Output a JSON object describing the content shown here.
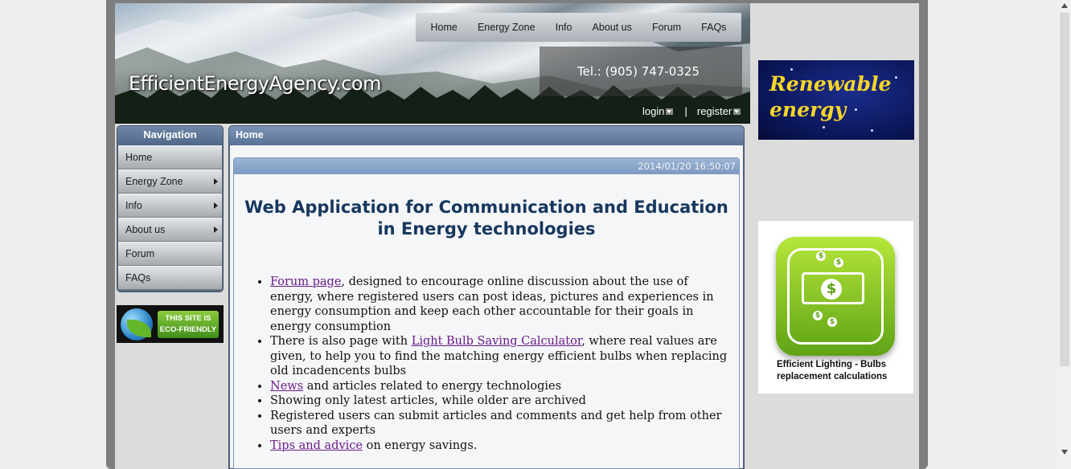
{
  "header": {
    "logo_text": "EfficientEnergyAgency.com",
    "phone": "Tel.: (905) 747-0325",
    "top_nav": [
      "Home",
      "Energy Zone",
      "Info",
      "About us",
      "Forum",
      "FAQs"
    ],
    "login_label": "login",
    "register_label": "register",
    "separator": "|"
  },
  "sidebar": {
    "title": "Navigation",
    "items": [
      {
        "label": "Home",
        "has_submenu": false
      },
      {
        "label": "Energy Zone",
        "has_submenu": true
      },
      {
        "label": "Info",
        "has_submenu": true
      },
      {
        "label": "About us",
        "has_submenu": true
      },
      {
        "label": "Forum",
        "has_submenu": false
      },
      {
        "label": "FAQs",
        "has_submenu": false
      }
    ],
    "eco_badge": "THIS SITE IS ECO-FRIENDLY"
  },
  "main": {
    "breadcrumb": "Home",
    "article": {
      "timestamp": "2014/01/20 16:50:07",
      "title": "Web Application for Communication and Education in Energy technologies",
      "bullets": [
        {
          "link": "Forum page",
          "text": ", designed to encourage online discussion about the use of energy, where registered users can post ideas, pictures and experiences in energy consumption and keep each other accountable for their goals in energy consumption"
        },
        {
          "prefix": "There is also page with ",
          "link": "Light Bulb Saving Calculator",
          "text": ", where real values are given, to help you to find the matching energy efficient bulbs when replacing old incadencents bulbs"
        },
        {
          "link": "News",
          "text": " and articles related to energy technologies"
        },
        {
          "text": "Showing only latest articles, while older are archived"
        },
        {
          "text": "Registered users can submit articles and comments and get help from other users and experts"
        },
        {
          "link": "Tips and advice",
          "text": " on energy savings."
        }
      ]
    }
  },
  "right_column": {
    "ad1_text": "Renewable energy",
    "ad2_caption": "Efficient Lighting - Bulbs replacement calculations"
  },
  "colors": {
    "title": "#17375e",
    "link": "#6a1a8a",
    "nav_blue": "#587196"
  }
}
